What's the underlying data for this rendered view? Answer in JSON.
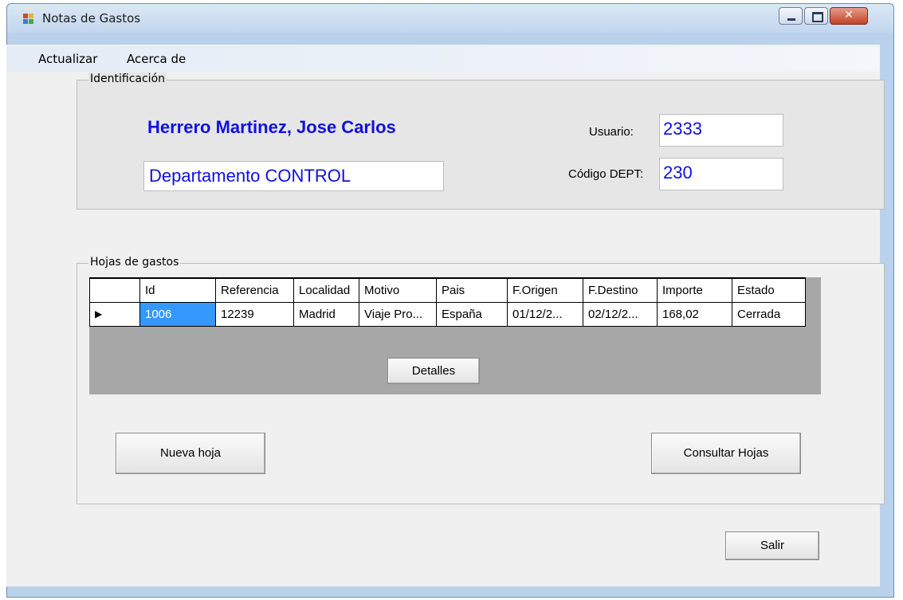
{
  "window": {
    "title": "Notas de Gastos",
    "controls": {
      "minimize": "minimize-icon",
      "maximize": "maximize-icon",
      "close": "close-icon"
    }
  },
  "menu": {
    "items": [
      "Actualizar",
      "Acerca de"
    ]
  },
  "identificacion": {
    "label": "Identificación",
    "employee_name": "Herrero Martinez, Jose Carlos",
    "department": "Departamento CONTROL",
    "usuario_label": "Usuario:",
    "usuario_value": "2333",
    "codigo_label": "Código DEPT:",
    "codigo_value": "230"
  },
  "hojas": {
    "label": "Hojas de gastos",
    "columns": [
      "Id",
      "Referencia",
      "Localidad",
      "Motivo",
      "Pais",
      "F.Origen",
      "F.Destino",
      "Importe",
      "Estado"
    ],
    "rows": [
      [
        "1006",
        "12239",
        "Madrid",
        "Viaje Pro...",
        "España",
        "01/12/2...",
        "02/12/2...",
        "168,02",
        "Cerrada"
      ]
    ],
    "row_indicator": "▶",
    "details_button": "Detalles",
    "new_button": "Nueva hoja",
    "consult_button": "Consultar Hojas"
  },
  "exit_button": "Salir",
  "colors": {
    "accent_text": "#1010e0",
    "selected_cell": "#3399ff"
  }
}
